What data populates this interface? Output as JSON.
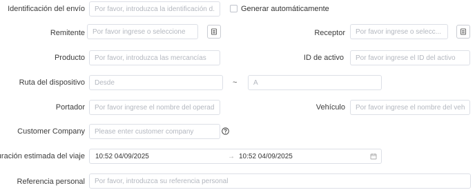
{
  "shipment_id": {
    "label": "Identificación del envío",
    "placeholder": "Por favor, introduzca la identificación d...",
    "auto_generate_label": "Generar automáticamente",
    "auto_generate_checked": false
  },
  "sender": {
    "label": "Remitente",
    "placeholder": "Por favor ingrese o seleccione",
    "picker_icon": "list-icon"
  },
  "receiver": {
    "label": "Receptor",
    "placeholder": "Por favor ingrese o selecc...",
    "picker_icon": "list-icon"
  },
  "product": {
    "label": "Producto",
    "placeholder": "Por favor, introduzca las mercancías"
  },
  "asset_id": {
    "label": "ID de activo",
    "placeholder": "Por favor ingrese el ID del activo"
  },
  "device_route": {
    "label": "Ruta del dispositivo",
    "from_placeholder": "Desde",
    "separator": "~",
    "to_placeholder": "A"
  },
  "carrier": {
    "label": "Portador",
    "placeholder": "Por favor ingrese el nombre del operad..."
  },
  "vehicle": {
    "label": "Vehículo",
    "placeholder": "Por favor ingrese el nombre del veh..."
  },
  "customer_company": {
    "label": "Customer Company",
    "placeholder": "Please enter customer company",
    "help_icon": "question-circle-icon"
  },
  "trip_duration": {
    "label": "Duración estimada del viaje",
    "start": "10:52 04/09/2025",
    "arrow": "→",
    "end": "10:52 04/09/2025",
    "calendar_icon": "calendar-icon"
  },
  "personal_reference": {
    "label": "Referencia personal",
    "placeholder": "Por favor, introduzca su referencia personal"
  },
  "colors": {
    "border": "#dcdfe6",
    "placeholder": "#b3b7bf",
    "label": "#3a3a3a"
  }
}
